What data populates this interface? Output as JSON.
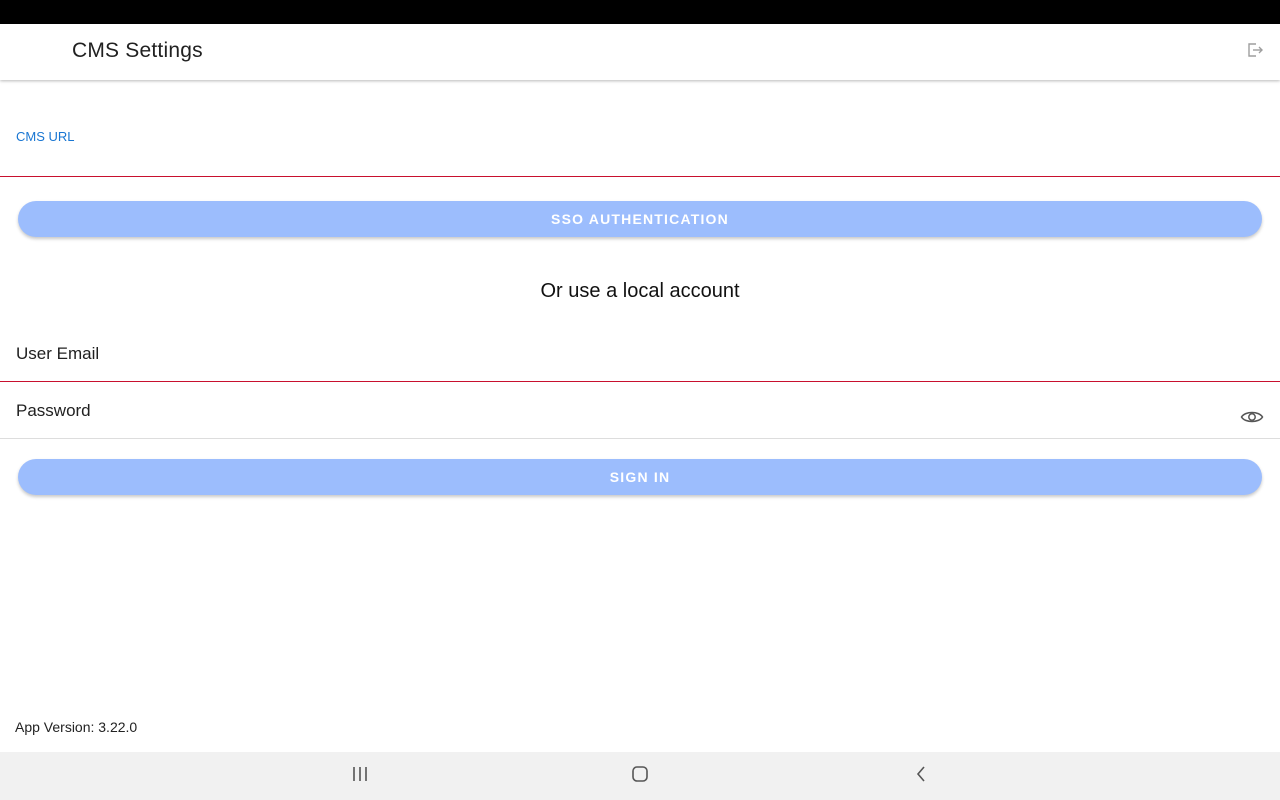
{
  "app_bar": {
    "title": "CMS Settings",
    "logout_icon": "logout-icon"
  },
  "cms_url": {
    "label": "CMS URL",
    "value": ""
  },
  "sso_button": {
    "label": "SSO AUTHENTICATION"
  },
  "divider_text": "Or use a local account",
  "email_field": {
    "label": "User Email",
    "value": ""
  },
  "password_field": {
    "label": "Password",
    "value": "",
    "toggle_icon": "eye-icon"
  },
  "signin_button": {
    "label": "SIGN IN"
  },
  "footer": {
    "app_version": "App Version: 3.22.0"
  },
  "nav_bar": {
    "recents_icon": "recents-icon",
    "home_icon": "home-icon",
    "back_icon": "back-icon"
  },
  "colors": {
    "accent_blue": "#1976d2",
    "button_fill": "#9cbdfd",
    "error_underline": "#c8102e"
  }
}
